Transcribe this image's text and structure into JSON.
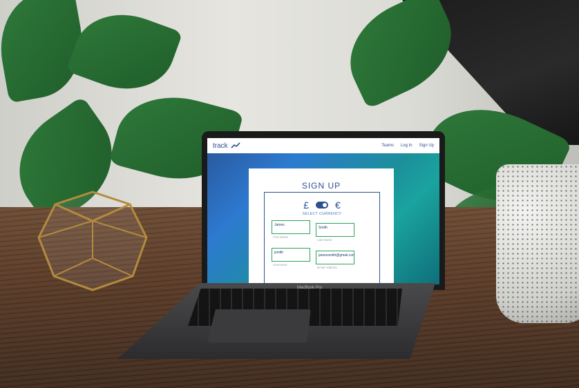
{
  "website": {
    "nav": {
      "logo": "track",
      "links": [
        "Teams",
        "Log In",
        "Sign Up"
      ]
    },
    "signup": {
      "title": "SIGN UP",
      "currency": {
        "left_symbol": "£",
        "right_symbol": "€",
        "label": "SELECT CURRENCY"
      },
      "fields": [
        {
          "value": "James",
          "label": "First Name"
        },
        {
          "value": "Smith",
          "label": "Last Name"
        },
        {
          "value": "jsmith",
          "label": "Username"
        },
        {
          "value": "jamessmith@gmail.com",
          "label": "Email Address"
        }
      ]
    }
  },
  "device": {
    "model_text": "MacBook Pro"
  }
}
